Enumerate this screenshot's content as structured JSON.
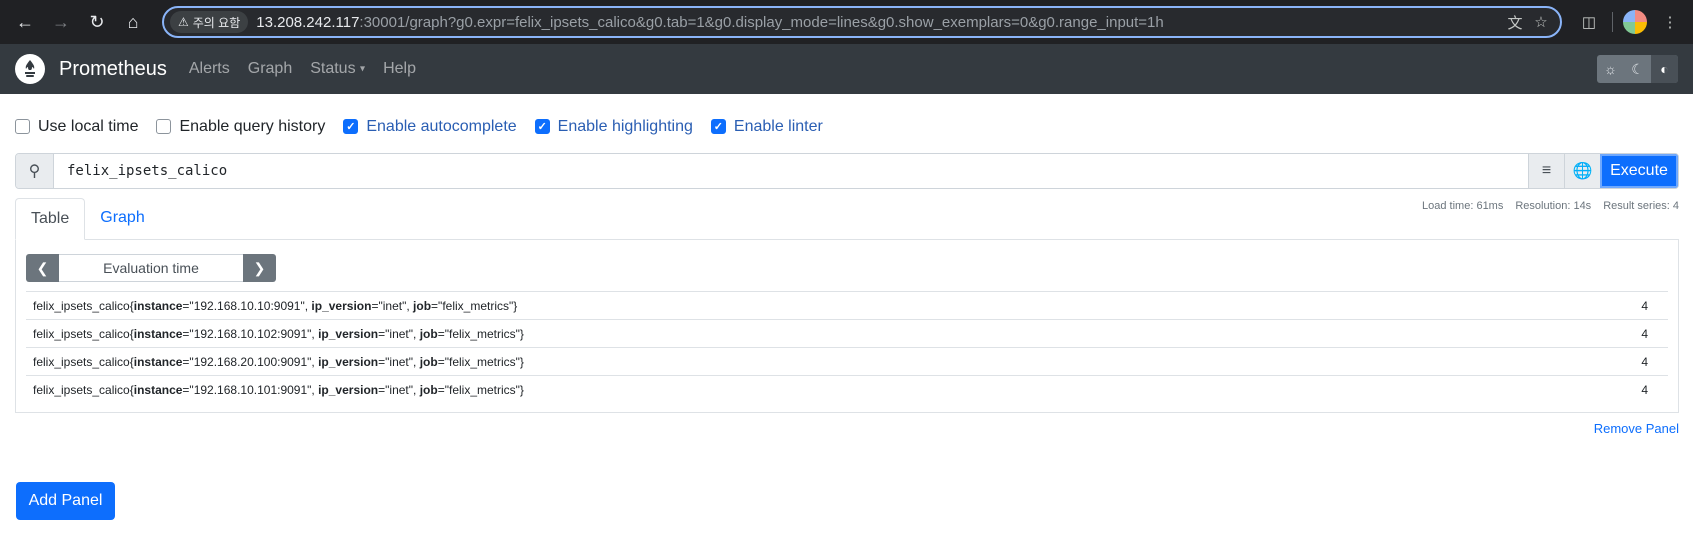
{
  "browser": {
    "security_label": "주의 요함",
    "url_host": "13.208.242.117",
    "url_rest": ":30001/graph?g0.expr=felix_ipsets_calico&g0.tab=1&g0.display_mode=lines&g0.show_exemplars=0&g0.range_input=1h",
    "icons": [
      "back-arrow-icon",
      "forward-arrow-icon",
      "reload-icon",
      "home-icon",
      "warning-icon",
      "translate-icon",
      "star-icon",
      "extensions-icon",
      "profile-avatar",
      "kebab-menu-icon"
    ]
  },
  "navbar": {
    "brand": "Prometheus",
    "links": [
      "Alerts",
      "Graph",
      "Status",
      "Help"
    ],
    "theme_icons": [
      "sun-icon",
      "moon-icon",
      "contrast-icon"
    ]
  },
  "options": [
    {
      "label": "Use local time",
      "checked": false
    },
    {
      "label": "Enable query history",
      "checked": false
    },
    {
      "label": "Enable autocomplete",
      "checked": true
    },
    {
      "label": "Enable highlighting",
      "checked": true
    },
    {
      "label": "Enable linter",
      "checked": true
    }
  ],
  "query": {
    "expression": "felix_ipsets_calico",
    "execute_label": "Execute"
  },
  "tabs": {
    "table": "Table",
    "graph": "Graph",
    "active": "Table"
  },
  "stats": {
    "load_time": "Load time: 61ms",
    "resolution": "Resolution: 14s",
    "result_series": "Result series: 4"
  },
  "eval_time_placeholder": "Evaluation time",
  "results": [
    {
      "metric": "felix_ipsets_calico",
      "instance": "192.168.10.10:9091",
      "ip_version": "inet",
      "job": "felix_metrics",
      "value": "4"
    },
    {
      "metric": "felix_ipsets_calico",
      "instance": "192.168.10.102:9091",
      "ip_version": "inet",
      "job": "felix_metrics",
      "value": "4"
    },
    {
      "metric": "felix_ipsets_calico",
      "instance": "192.168.20.100:9091",
      "ip_version": "inet",
      "job": "felix_metrics",
      "value": "4"
    },
    {
      "metric": "felix_ipsets_calico",
      "instance": "192.168.10.101:9091",
      "ip_version": "inet",
      "job": "felix_metrics",
      "value": "4"
    }
  ],
  "remove_panel": "Remove Panel",
  "add_panel": "Add Panel"
}
